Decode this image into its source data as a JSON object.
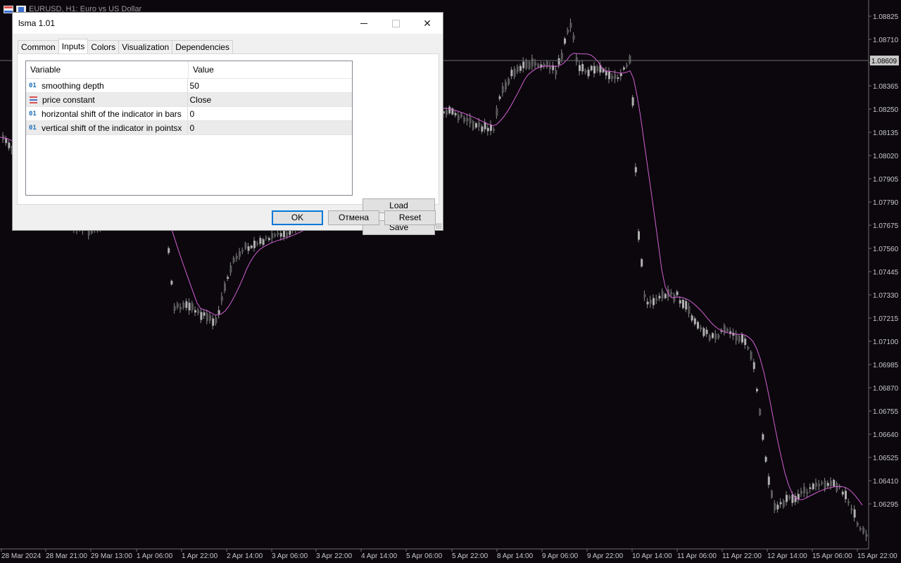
{
  "chart": {
    "symbol_title": "EURUSD, H1:  Euro vs US Dollar",
    "current_price": "1.08609",
    "price_labels": [
      "1.08825",
      "1.08710",
      "1.08480",
      "1.08365",
      "1.08250",
      "1.08135",
      "1.08020",
      "1.07905",
      "1.07790",
      "1.07675",
      "1.07560",
      "1.07445",
      "1.07330",
      "1.07215",
      "1.07100",
      "1.06985",
      "1.06870",
      "1.06755",
      "1.06640",
      "1.06525",
      "1.06410",
      "1.06295"
    ],
    "time_labels": [
      "28 Mar 2024",
      "28 Mar 21:00",
      "29 Mar 13:00",
      "1 Apr 06:00",
      "1 Apr 22:00",
      "2 Apr 14:00",
      "3 Apr 06:00",
      "3 Apr 22:00",
      "4 Apr 14:00",
      "5 Apr 06:00",
      "5 Apr 22:00",
      "8 Apr 14:00",
      "9 Apr 06:00",
      "9 Apr 22:00",
      "10 Apr 14:00",
      "11 Apr 06:00",
      "11 Apr 22:00",
      "12 Apr 14:00",
      "15 Apr 06:00",
      "15 Apr 22:00"
    ],
    "colors": {
      "background": "#0b070d",
      "candles": "#8c8c8c",
      "ma_line": "#d25fd2",
      "axis_text": "#c8c8c8",
      "price_marker": "#c8c8c8"
    }
  },
  "dialog": {
    "title": "lsma 1.01",
    "controls": {
      "minimize": "minimize-icon",
      "maximize": "maximize-icon",
      "close": "✕"
    },
    "tabs": [
      "Common",
      "Inputs",
      "Colors",
      "Visualization",
      "Dependencies"
    ],
    "active_tab": "Inputs",
    "grid": {
      "headers": {
        "variable": "Variable",
        "value": "Value"
      },
      "rows": [
        {
          "icon": "01",
          "variable": "smoothing depth",
          "value": "50"
        },
        {
          "icon": "list-icon",
          "variable": "price constant",
          "value": "Close"
        },
        {
          "icon": "01",
          "variable": "horizontal shift of the indicator in bars",
          "value": "0"
        },
        {
          "icon": "01",
          "variable": "vertical shift of the indicator in pointsx",
          "value": "0"
        }
      ]
    },
    "buttons": {
      "load": "Load",
      "save": "Save",
      "ok": "OK",
      "cancel": "Отмена",
      "reset": "Reset"
    }
  }
}
